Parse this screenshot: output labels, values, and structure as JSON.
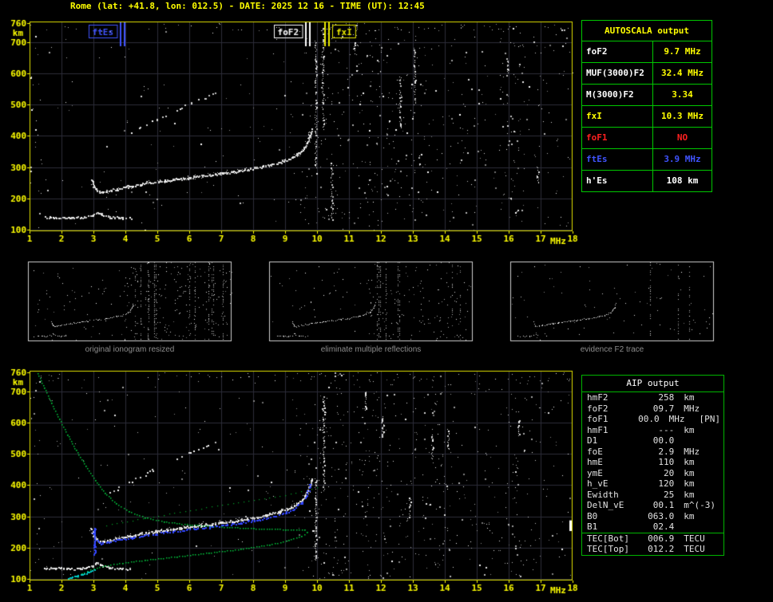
{
  "header": {
    "title": "Rome (lat: +41.8, lon: 012.5) - DATE: 2025 12 16 - TIME (UT): 12:45"
  },
  "colors": {
    "axis": "#ffff00",
    "grid": "#2c2d38",
    "border": "#e0e000",
    "table_green": "#00c800",
    "marker_blue": "#4054ff",
    "status_red": "#ff2020",
    "profile_green": "#00c83c",
    "trace_blue": "#3246ff",
    "cyan": "#00c8c8",
    "caption_gray": "#8c8c8c",
    "thumb_border": "#cfcfcf"
  },
  "autoscala": {
    "title": "AUTOSCALA output",
    "rows": [
      {
        "label": "foF2",
        "value": "9.7 MHz",
        "label_color": "#ffffff",
        "value_color": "#ffff00"
      },
      {
        "label": "MUF(3000)F2",
        "value": "32.4 MHz",
        "label_color": "#ffffff",
        "value_color": "#ffff00"
      },
      {
        "label": "M(3000)F2",
        "value": "3.34",
        "label_color": "#ffffff",
        "value_color": "#ffff00"
      },
      {
        "label": "fxI",
        "value": "10.3 MHz",
        "label_color": "#ffff00",
        "value_color": "#ffff00"
      },
      {
        "label": "foF1",
        "value": "NO",
        "label_color": "#ff2020",
        "value_color": "#ff2020"
      },
      {
        "label": "ftEs",
        "value": "3.9 MHz",
        "label_color": "#4054ff",
        "value_color": "#4054ff"
      },
      {
        "label": "h'Es",
        "value": "108  km",
        "label_color": "#ffffff",
        "value_color": "#ffffff"
      }
    ]
  },
  "aip": {
    "title": "AIP output",
    "rows": [
      {
        "name": "hmF2",
        "value": "258",
        "unit": "km",
        "extra": ""
      },
      {
        "name": "foF2",
        "value": "09.7",
        "unit": "MHz",
        "extra": ""
      },
      {
        "name": "foF1",
        "value": "00.0",
        "unit": "MHz",
        "extra": "[PN]"
      },
      {
        "name": "hmF1",
        "value": "---",
        "unit": "km",
        "extra": ""
      },
      {
        "name": "D1",
        "value": "00.0",
        "unit": "",
        "extra": ""
      },
      {
        "name": "foE",
        "value": "2.9",
        "unit": "MHz",
        "extra": ""
      },
      {
        "name": "hmE",
        "value": "110",
        "unit": "km",
        "extra": ""
      },
      {
        "name": "ymE",
        "value": "20",
        "unit": "km",
        "extra": ""
      },
      {
        "name": "h_vE",
        "value": "120",
        "unit": "km",
        "extra": ""
      },
      {
        "name": "Ewidth",
        "value": "25",
        "unit": "km",
        "extra": ""
      },
      {
        "name": "DelN_vE",
        "value": "00.1",
        "unit": "m^(-3)",
        "extra": ""
      },
      {
        "name": "B0",
        "value": "063.0",
        "unit": "km",
        "extra": ""
      },
      {
        "name": "B1",
        "value": "02.4",
        "unit": "",
        "extra": ""
      },
      {
        "name": "TEC[Bot]",
        "value": "006.9",
        "unit": "TECU",
        "extra": "",
        "sep": true
      },
      {
        "name": "TEC[Top]",
        "value": "012.2",
        "unit": "TECU",
        "extra": ""
      }
    ]
  },
  "thumbnails": [
    {
      "caption": "original ionogram resized"
    },
    {
      "caption": "eliminate multiple reflections"
    },
    {
      "caption": "evidence F2 trace"
    }
  ],
  "chart_data": [
    {
      "id": "top_ionogram",
      "type": "scatter",
      "title": "ionogram with AUTOSCALA characteristic markers",
      "xlabel": "MHz",
      "ylabel": "km",
      "xlim": [
        1,
        18
      ],
      "ylim": [
        95,
        765
      ],
      "xticks": [
        1,
        2,
        3,
        4,
        5,
        6,
        7,
        8,
        9,
        10,
        11,
        12,
        13,
        14,
        15,
        16,
        17,
        18
      ],
      "yticks": [
        100,
        200,
        300,
        400,
        500,
        600,
        700,
        760
      ],
      "grid": true,
      "noise_count": 520,
      "markers": [
        {
          "label": "ftEs",
          "freq": 3.9,
          "color": "#4054ff",
          "side": "left"
        },
        {
          "label": "foF2",
          "freq": 9.7,
          "color": "#ffffff",
          "side": "left"
        },
        {
          "label": "fxI",
          "freq": 10.3,
          "color": "#e8e800",
          "side": "right"
        }
      ],
      "series": [
        {
          "name": "Es-trace",
          "points": [
            [
              1.45,
              141
            ],
            [
              1.8,
              140
            ],
            [
              2.2,
              139
            ],
            [
              2.6,
              140
            ],
            [
              2.95,
              146
            ],
            [
              3.1,
              158
            ],
            [
              3.25,
              150
            ],
            [
              3.5,
              142
            ],
            [
              3.8,
              140
            ],
            [
              4.15,
              139
            ]
          ]
        },
        {
          "name": "F2-trace",
          "points": [
            [
              2.92,
              262
            ],
            [
              3.0,
              240
            ],
            [
              3.08,
              228
            ],
            [
              3.2,
              221
            ],
            [
              3.4,
              224
            ],
            [
              3.7,
              230
            ],
            [
              4.0,
              237
            ],
            [
              4.5,
              246
            ],
            [
              5.0,
              254
            ],
            [
              5.5,
              261
            ],
            [
              6.0,
              268
            ],
            [
              6.5,
              274
            ],
            [
              7.0,
              281
            ],
            [
              7.5,
              288
            ],
            [
              8.0,
              297
            ],
            [
              8.4,
              305
            ],
            [
              8.8,
              315
            ],
            [
              9.1,
              326
            ],
            [
              9.35,
              340
            ],
            [
              9.55,
              357
            ],
            [
              9.68,
              377
            ],
            [
              9.76,
              398
            ],
            [
              9.81,
              420
            ]
          ]
        },
        {
          "name": "F2-multiple",
          "points": [
            [
              3.08,
              350
            ],
            [
              3.5,
              372
            ],
            [
              3.95,
              398
            ],
            [
              4.45,
              426
            ],
            [
              4.95,
              452
            ],
            [
              5.5,
              480
            ],
            [
              6.05,
              506
            ],
            [
              6.5,
              524
            ],
            [
              6.85,
              540
            ]
          ]
        }
      ],
      "noise_bands": [
        [
          1.0,
          1.35
        ],
        [
          9.9,
          10.85
        ],
        [
          11.2,
          12.6
        ],
        [
          12.9,
          13.45
        ],
        [
          15.7,
          16.35
        ]
      ],
      "streaks": [
        [
          13.05,
          500,
          680
        ],
        [
          12.6,
          430,
          590
        ],
        [
          10.18,
          420,
          745
        ],
        [
          15.95,
          595,
          648
        ],
        [
          9.95,
          300,
          700
        ],
        [
          10.45,
          130,
          300
        ],
        [
          16.9,
          250,
          305
        ],
        [
          11.15,
          650,
          700
        ]
      ]
    },
    {
      "id": "bottom_ionogram",
      "type": "scatter",
      "title": "ionogram with AIP restored trace and electron density profile",
      "xlabel": "MHz",
      "ylabel": "km",
      "xlim": [
        1,
        18
      ],
      "ylim": [
        95,
        765
      ],
      "xticks": [
        1,
        2,
        3,
        4,
        5,
        6,
        7,
        8,
        9,
        10,
        11,
        12,
        13,
        14,
        15,
        16,
        17,
        18
      ],
      "yticks": [
        100,
        200,
        300,
        400,
        500,
        600,
        700,
        760
      ],
      "grid": true,
      "noise_count": 560,
      "series": [
        {
          "name": "Es-trace",
          "points": [
            [
              1.45,
              136
            ],
            [
              1.8,
              135
            ],
            [
              2.2,
              134
            ],
            [
              2.6,
              135
            ],
            [
              2.95,
              141
            ],
            [
              3.1,
              152
            ],
            [
              3.25,
              145
            ],
            [
              3.5,
              137
            ],
            [
              3.8,
              135
            ],
            [
              4.15,
              134
            ]
          ]
        },
        {
          "name": "F2-trace",
          "points": [
            [
              2.92,
              262
            ],
            [
              3.0,
              240
            ],
            [
              3.08,
              228
            ],
            [
              3.2,
              221
            ],
            [
              3.4,
              224
            ],
            [
              3.7,
              230
            ],
            [
              4.0,
              237
            ],
            [
              4.5,
              246
            ],
            [
              5.0,
              254
            ],
            [
              5.5,
              261
            ],
            [
              6.0,
              268
            ],
            [
              6.5,
              274
            ],
            [
              7.0,
              281
            ],
            [
              7.5,
              288
            ],
            [
              8.0,
              297
            ],
            [
              8.4,
              305
            ],
            [
              8.8,
              315
            ],
            [
              9.1,
              326
            ],
            [
              9.35,
              340
            ],
            [
              9.55,
              357
            ],
            [
              9.68,
              377
            ],
            [
              9.76,
              398
            ],
            [
              9.81,
              420
            ]
          ]
        },
        {
          "name": "F2-multiple",
          "points": [
            [
              3.3,
              365
            ],
            [
              3.8,
              392
            ],
            [
              4.3,
              420
            ],
            [
              4.85,
              448
            ],
            [
              5.45,
              478
            ],
            [
              6.0,
              504
            ],
            [
              6.5,
              526
            ],
            [
              6.9,
              544
            ]
          ]
        }
      ],
      "profile": {
        "name": "electron-density-profile",
        "color": "#00c83c",
        "points": [
          [
            1.25,
            758
          ],
          [
            1.45,
            712
          ],
          [
            1.68,
            662
          ],
          [
            1.92,
            612
          ],
          [
            2.18,
            562
          ],
          [
            2.45,
            512
          ],
          [
            2.75,
            462
          ],
          [
            3.05,
            415
          ],
          [
            3.35,
            376
          ],
          [
            3.7,
            342
          ],
          [
            4.1,
            316
          ],
          [
            4.6,
            297
          ],
          [
            5.2,
            284
          ],
          [
            6.0,
            274
          ],
          [
            7.0,
            267
          ],
          [
            8.0,
            262
          ],
          [
            9.0,
            259
          ],
          [
            9.6,
            258
          ],
          [
            9.68,
            250
          ],
          [
            9.5,
            238
          ],
          [
            9.1,
            224
          ],
          [
            8.5,
            210
          ],
          [
            7.6,
            196
          ],
          [
            6.6,
            184
          ],
          [
            5.6,
            172
          ],
          [
            4.6,
            161
          ],
          [
            3.9,
            152
          ],
          [
            3.35,
            143
          ],
          [
            3.0,
            134
          ],
          [
            2.8,
            126
          ],
          [
            2.62,
            117
          ],
          [
            2.5,
            107
          ],
          [
            2.42,
            100
          ]
        ]
      },
      "profile_extension": {
        "name": "topside-dotted-line",
        "color": "#00a028",
        "points": [
          [
            3.4,
            272
          ],
          [
            5.2,
            305
          ],
          [
            7.2,
            340
          ],
          [
            9.0,
            368
          ],
          [
            10.0,
            392
          ]
        ]
      },
      "model_trace": {
        "name": "restored-trace-blue",
        "color": "#3246ff",
        "points": [
          [
            2.98,
            250
          ],
          [
            3.06,
            230
          ],
          [
            3.2,
            216
          ],
          [
            3.45,
            219
          ],
          [
            3.8,
            226
          ],
          [
            4.2,
            233
          ],
          [
            4.7,
            241
          ],
          [
            5.2,
            249
          ],
          [
            5.8,
            257
          ],
          [
            6.4,
            264
          ],
          [
            7.0,
            272
          ],
          [
            7.6,
            280
          ],
          [
            8.1,
            290
          ],
          [
            8.6,
            300
          ],
          [
            9.0,
            312
          ],
          [
            9.3,
            327
          ],
          [
            9.5,
            344
          ],
          [
            9.65,
            365
          ],
          [
            9.74,
            390
          ],
          [
            9.79,
            412
          ]
        ]
      },
      "blue_vertical": {
        "freq": 3.02,
        "km": [
          180,
          265
        ]
      },
      "cyan_trace": {
        "name": "E-region-cyan",
        "color": "#00c8c8",
        "points": [
          [
            2.2,
            102
          ],
          [
            2.5,
            112
          ],
          [
            2.8,
            122
          ],
          [
            3.02,
            130
          ]
        ]
      },
      "edge_tick_km": [
        253,
        287
      ],
      "noise_bands": [
        [
          1.0,
          1.35
        ],
        [
          9.9,
          10.9
        ],
        [
          11.3,
          12.3
        ],
        [
          13.3,
          14.2
        ],
        [
          15.9,
          16.5
        ]
      ],
      "streaks": [
        [
          13.6,
          480,
          560
        ],
        [
          10.2,
          380,
          690
        ],
        [
          12.05,
          555,
          620
        ],
        [
          14.1,
          515,
          580
        ],
        [
          9.95,
          160,
          420
        ],
        [
          16.3,
          555,
          610
        ],
        [
          11.5,
          640,
          700
        ],
        [
          12.9,
          300,
          360
        ]
      ]
    }
  ]
}
